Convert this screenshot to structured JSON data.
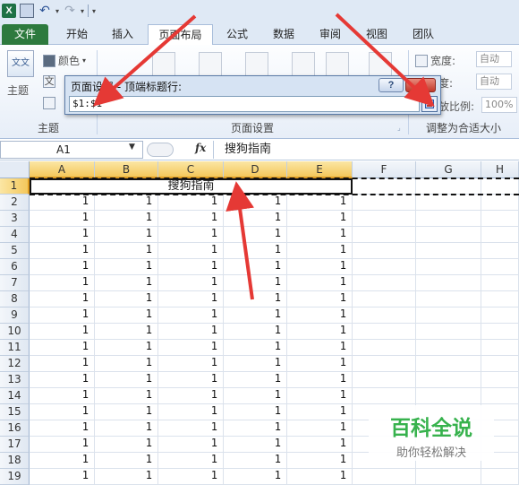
{
  "quick_access": {
    "app_icon": "excel-icon",
    "icons": [
      "save-icon",
      "undo-icon",
      "redo-icon",
      "customize-icon"
    ],
    "app_letter": "X"
  },
  "tabs": [
    {
      "label": "文件",
      "active": false,
      "style": "file"
    },
    {
      "label": "开始",
      "active": false
    },
    {
      "label": "插入",
      "active": false
    },
    {
      "label": "页面布局",
      "active": true
    },
    {
      "label": "公式",
      "active": false
    },
    {
      "label": "数据",
      "active": false
    },
    {
      "label": "审阅",
      "active": false
    },
    {
      "label": "视图",
      "active": false
    },
    {
      "label": "团队",
      "active": false
    }
  ],
  "ribbon": {
    "themes_label": "主题",
    "colors_label": "颜色",
    "text_label": "文",
    "font_label": "字",
    "group_themes": "主题",
    "group_page_setup": "页面设置",
    "group_scale": "调整为合适大小",
    "width_label": "宽度:",
    "width_value": "自动",
    "height_label": "度:",
    "height_value": "自动",
    "scale_label": "缩放比例:",
    "scale_value": "100%"
  },
  "dialog": {
    "title": "页面设置 - 顶端标题行:",
    "help": "?",
    "close": "x",
    "range_value": "$1:$1"
  },
  "formula_bar": {
    "name_box": "A1",
    "fx": "fx",
    "content": "搜狗指南"
  },
  "sheet": {
    "columns": [
      "A",
      "B",
      "C",
      "D",
      "E",
      "F",
      "G",
      "H"
    ],
    "selected_columns": [
      "A",
      "B",
      "C",
      "D",
      "E"
    ],
    "rows": [
      "1",
      "2",
      "3",
      "4",
      "5",
      "6",
      "7",
      "8",
      "9",
      "10",
      "11",
      "12",
      "13",
      "14",
      "15",
      "16",
      "17",
      "18",
      "19"
    ],
    "merged_title": "搜狗指南",
    "cell_value": "1"
  },
  "watermark": {
    "title": "百科全说",
    "subtitle": "助你轻松解决"
  },
  "colors": {
    "file_tab": "#2d7a3e",
    "selection_header": "#f4c85c",
    "arrow": "#e53935",
    "watermark": "#37b24d"
  }
}
